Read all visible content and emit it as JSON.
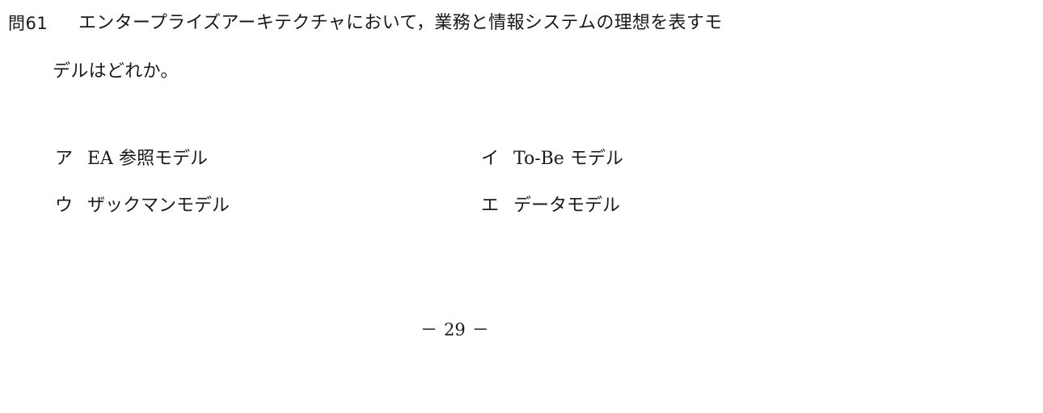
{
  "question": {
    "number": "問61",
    "line1": "エンタープライズアーキテクチャにおいて，業務と情報システムの理想を表すモ",
    "line2": "デルはどれか。"
  },
  "choices": [
    {
      "label": "ア",
      "text": "EA 参照モデル"
    },
    {
      "label": "イ",
      "text": "To-Be モデル"
    },
    {
      "label": "ウ",
      "text": "ザックマンモデル"
    },
    {
      "label": "エ",
      "text": "データモデル"
    }
  ],
  "footer": {
    "dash_left": "－",
    "page_number": "29",
    "dash_right": "－"
  }
}
